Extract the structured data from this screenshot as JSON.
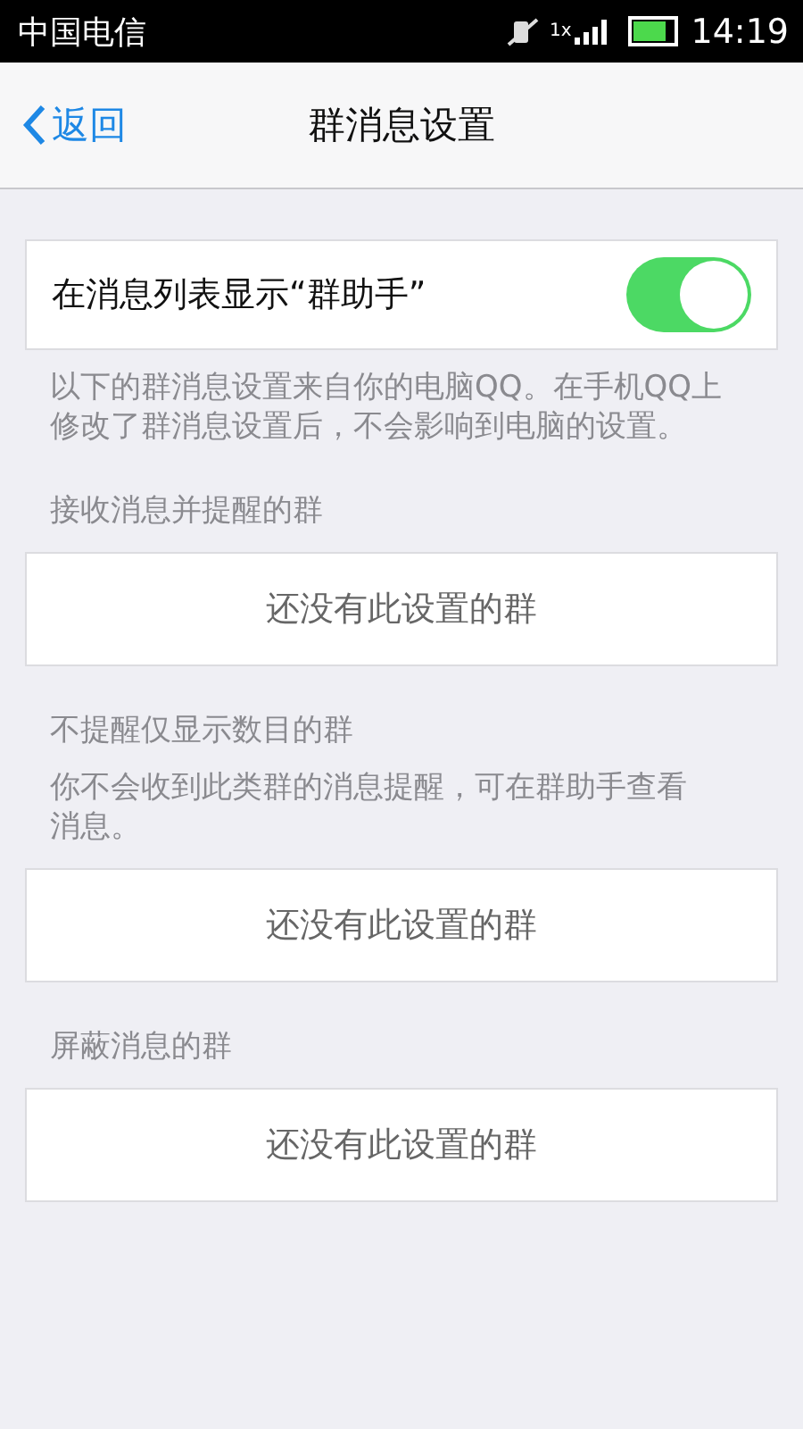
{
  "status_bar": {
    "carrier": "中国电信",
    "network": "1x",
    "time": "14:19"
  },
  "nav": {
    "back": "返回",
    "title": "群消息设置"
  },
  "toggle_row": {
    "label": "在消息列表显示“群助手”",
    "on": true
  },
  "description": "以下的群消息设置来自你的电脑QQ。在手机QQ上修改了群消息设置后，不会影响到电脑的设置。",
  "sections": [
    {
      "title": "接收消息并提醒的群",
      "empty_text": "还没有此设置的群"
    },
    {
      "title": "不提醒仅显示数目的群",
      "note": "你不会收到此类群的消息提醒，可在群助手查看消息。",
      "empty_text": "还没有此设置的群"
    },
    {
      "title": "屏蔽消息的群",
      "empty_text": "还没有此设置的群"
    }
  ]
}
